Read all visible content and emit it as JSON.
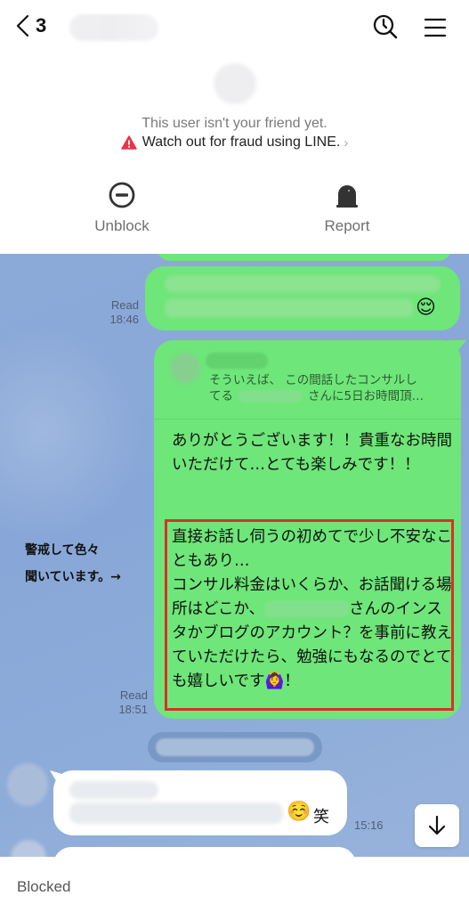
{
  "header": {
    "back_count": "3",
    "icons": {
      "back": "chevron-left-icon",
      "search": "search-history-icon",
      "menu": "hamburger-menu-icon"
    }
  },
  "notice": {
    "not_friend": "This user isn't your friend yet.",
    "fraud_warning": "Watch out for fraud using LINE.",
    "warning_icon": "warning-triangle-icon",
    "warning_color": "#e8344a"
  },
  "actions": [
    {
      "label": "Unblock",
      "icon": "minus-circle-icon"
    },
    {
      "label": "Report",
      "icon": "siren-icon"
    }
  ],
  "messages": {
    "m1": {
      "read_label": "Read",
      "time": "18:46",
      "emoji": "😌"
    },
    "m2": {
      "read_label": "Read",
      "time": "18:51",
      "reply_preview": "そういえば、 この間話したコンサルしてる　　　　　　さんに5日お時間頂…",
      "reply_line1": "そういえば、 この間話したコンサルし",
      "reply_line2_start": "てる",
      "reply_line2_end": "さんに5日お時間頂…",
      "text_main": "ありがとうございます！！貴重なお時間いただけて…とても楽しみです！！",
      "text_highlight_part1": "直接お話し伺うの初めてで少し不安なこともあり…\nコンサル料金はいくらか、お話聞ける場所はどこか、",
      "text_highlight_part2": "さんのインスタかブログのアカウント？を事前に教えていただけたら、勉強にもなるのでとても嬉しいです",
      "text_highlight_emoji": "🙆‍♀️",
      "text_highlight_end": "！"
    },
    "m3": {
      "time": "15:16",
      "emoji": "☺️",
      "suffix": "笑"
    }
  },
  "annotation": {
    "line1": "警戒して色々",
    "line2": "聞いています。→"
  },
  "colors": {
    "chat_bg": "#8caad8",
    "sent_bubble": "#6ee679",
    "received_bubble": "#ffffff",
    "highlight_border": "#d8302a"
  },
  "footer": {
    "status": "Blocked"
  },
  "scroll_button_icon": "arrow-down-icon"
}
